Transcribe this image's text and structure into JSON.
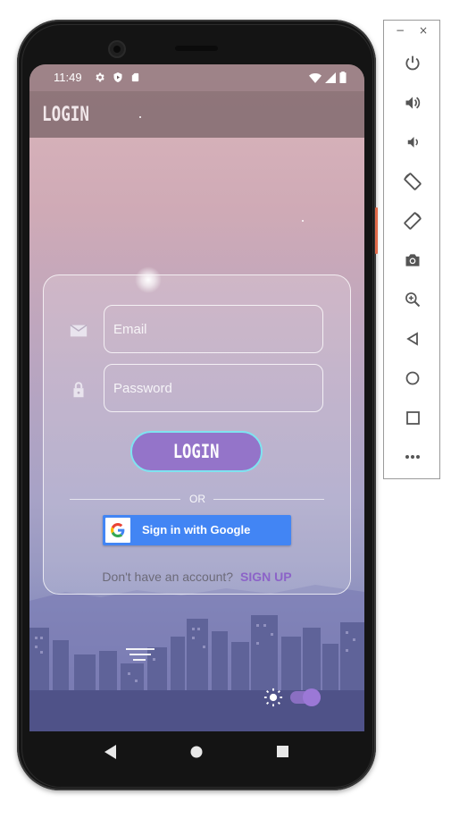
{
  "status_bar": {
    "time": "11:49",
    "left_icons": [
      "gear-icon",
      "play-protect-icon",
      "sd-card-icon"
    ],
    "right_icons": [
      "wifi-icon",
      "signal-icon",
      "battery-icon"
    ]
  },
  "app_bar": {
    "title": "LOGIN"
  },
  "form": {
    "email_placeholder": "Email",
    "password_placeholder": "Password",
    "login_button": "LOGIN",
    "divider_text": "OR",
    "google_button": "Sign in with Google",
    "signup_prompt": "Don't have an account?",
    "signup_link": "SIGN UP"
  },
  "theme_toggle": {
    "light_icon": "sun-icon",
    "dark_icon": "moon-icon",
    "state": "dark"
  },
  "navigation": {
    "buttons": [
      "back-icon",
      "home-icon",
      "recents-icon"
    ]
  },
  "emulator_toolbar": {
    "window_controls": [
      "−",
      "×"
    ],
    "tools": [
      "power-icon",
      "volume-up-icon",
      "volume-down-icon",
      "rotate-left-icon",
      "rotate-right-icon",
      "camera-icon",
      "zoom-in-icon",
      "back-icon",
      "home-icon",
      "overview-icon",
      "more-icon"
    ]
  },
  "colors": {
    "accent": "#9474c9",
    "button_border": "#7fe3f0",
    "google_blue": "#4285f4",
    "signup_link": "#8c63c8"
  }
}
